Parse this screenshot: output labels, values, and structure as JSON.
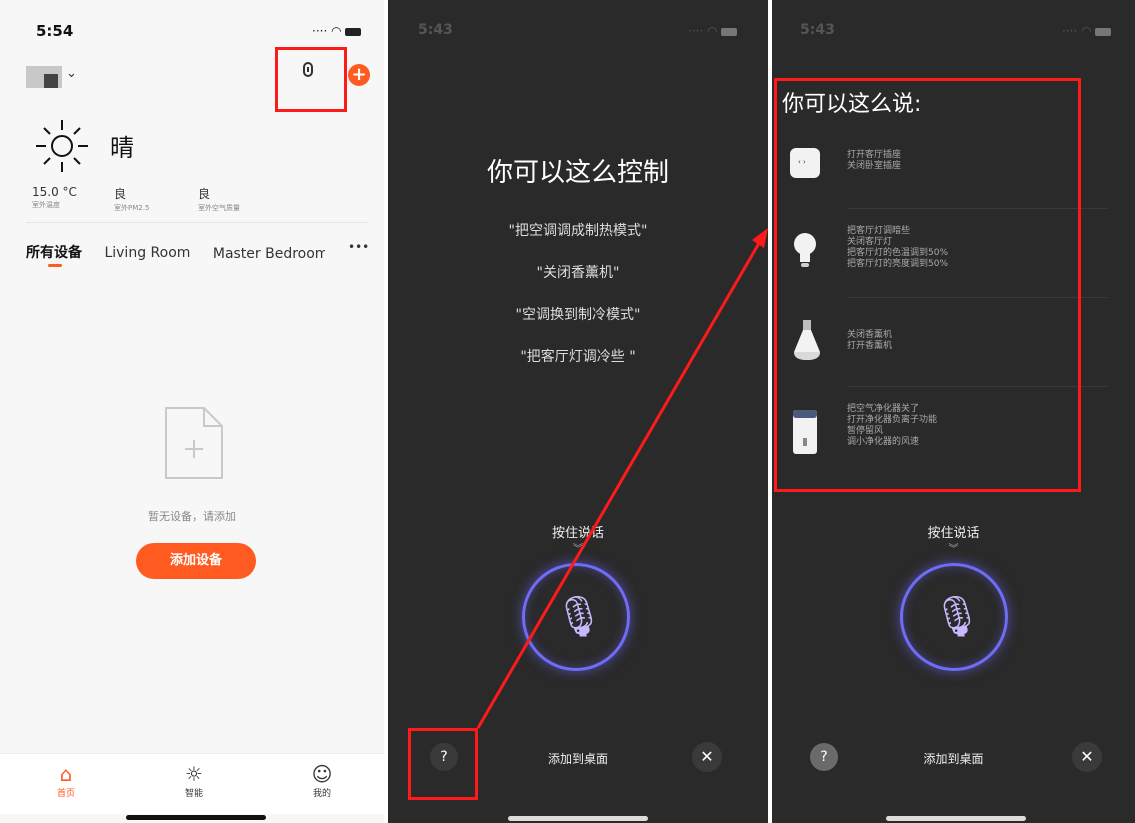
{
  "screen1": {
    "time": "5:54",
    "weather": {
      "condition": "晴",
      "stats": [
        {
          "value": "15.0 °C",
          "label": "室外温度"
        },
        {
          "value": "良",
          "label": "室外PM2.5"
        },
        {
          "value": "良",
          "label": "室外空气质量"
        }
      ]
    },
    "tabs": [
      "所有设备",
      "Living Room",
      "Master Bedroom"
    ],
    "more": "•••",
    "empty_text": "暂无设备，请添加",
    "add_button": "添加设备",
    "nav": [
      {
        "label": "首页",
        "icon": "home-icon"
      },
      {
        "label": "智能",
        "icon": "smart-sun-icon"
      },
      {
        "label": "我的",
        "icon": "profile-icon"
      }
    ],
    "accent": "#ff5a1f"
  },
  "screen2": {
    "time": "5:43",
    "title": "你可以这么控制",
    "hints": [
      "\"把空调调成制热模式\"",
      "\"关闭香薰机\"",
      "\"空调换到制冷模式\"",
      "\"把客厅灯调冷些 \""
    ],
    "hold_to_talk": "按住说话",
    "help": "?",
    "add_to_desktop": "添加到桌面",
    "close": "✕"
  },
  "screen3": {
    "time": "5:43",
    "title": "你可以这么说:",
    "suggestions": [
      {
        "icon": "socket-icon",
        "lines": [
          "打开客厅插座",
          "关闭卧室插座"
        ]
      },
      {
        "icon": "bulb-icon",
        "lines": [
          "把客厅灯调暗些",
          "关闭客厅灯",
          "把客厅灯的色温调到50%",
          "把客厅灯的亮度调到50%"
        ]
      },
      {
        "icon": "aroma-diffuser-icon",
        "lines": [
          "关闭香薰机",
          "打开香薰机"
        ]
      },
      {
        "icon": "air-purifier-icon",
        "lines": [
          "把空气净化器关了",
          "打开净化器负离子功能",
          "暂停留风",
          "调小净化器的风速"
        ]
      }
    ],
    "hold_to_talk": "按住说话",
    "help": "?",
    "add_to_desktop": "添加到桌面",
    "close": "✕"
  },
  "annotation_color": "#ff1a1a"
}
